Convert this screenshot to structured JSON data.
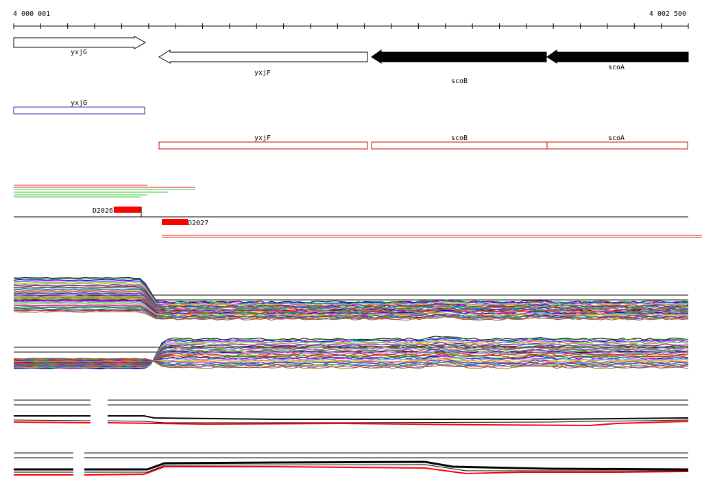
{
  "ruler": {
    "start_label": "4 000 001",
    "end_label": "4 002 500"
  },
  "genes": [
    {
      "name": "yxjG",
      "strand": "+",
      "fill": "#ffffff"
    },
    {
      "name": "yxjF",
      "strand": "-",
      "fill": "#ffffff"
    },
    {
      "name": "scoB",
      "strand": "-",
      "fill": "#000000"
    },
    {
      "name": "scoA",
      "strand": "-",
      "fill": "#000000"
    }
  ],
  "annotations": [
    {
      "name": "yxjG",
      "color": "#1f2fb0"
    },
    {
      "name": "yxjF",
      "color": "#cc0000"
    },
    {
      "name": "scoB",
      "color": "#cc0000"
    },
    {
      "name": "scoA",
      "color": "#cc0000"
    }
  ],
  "features": [
    {
      "name": "D2026",
      "color": "#ff0000"
    },
    {
      "name": "D2027",
      "color": "#ff0000"
    }
  ],
  "colors": {
    "ruler": "#000000",
    "feature": "#ff0000",
    "track_black": "#000000",
    "track_red": "#ff0000",
    "short_reads_red": "#dd2222",
    "short_reads_green": "#33cc33",
    "panel_border": "#000000"
  }
}
